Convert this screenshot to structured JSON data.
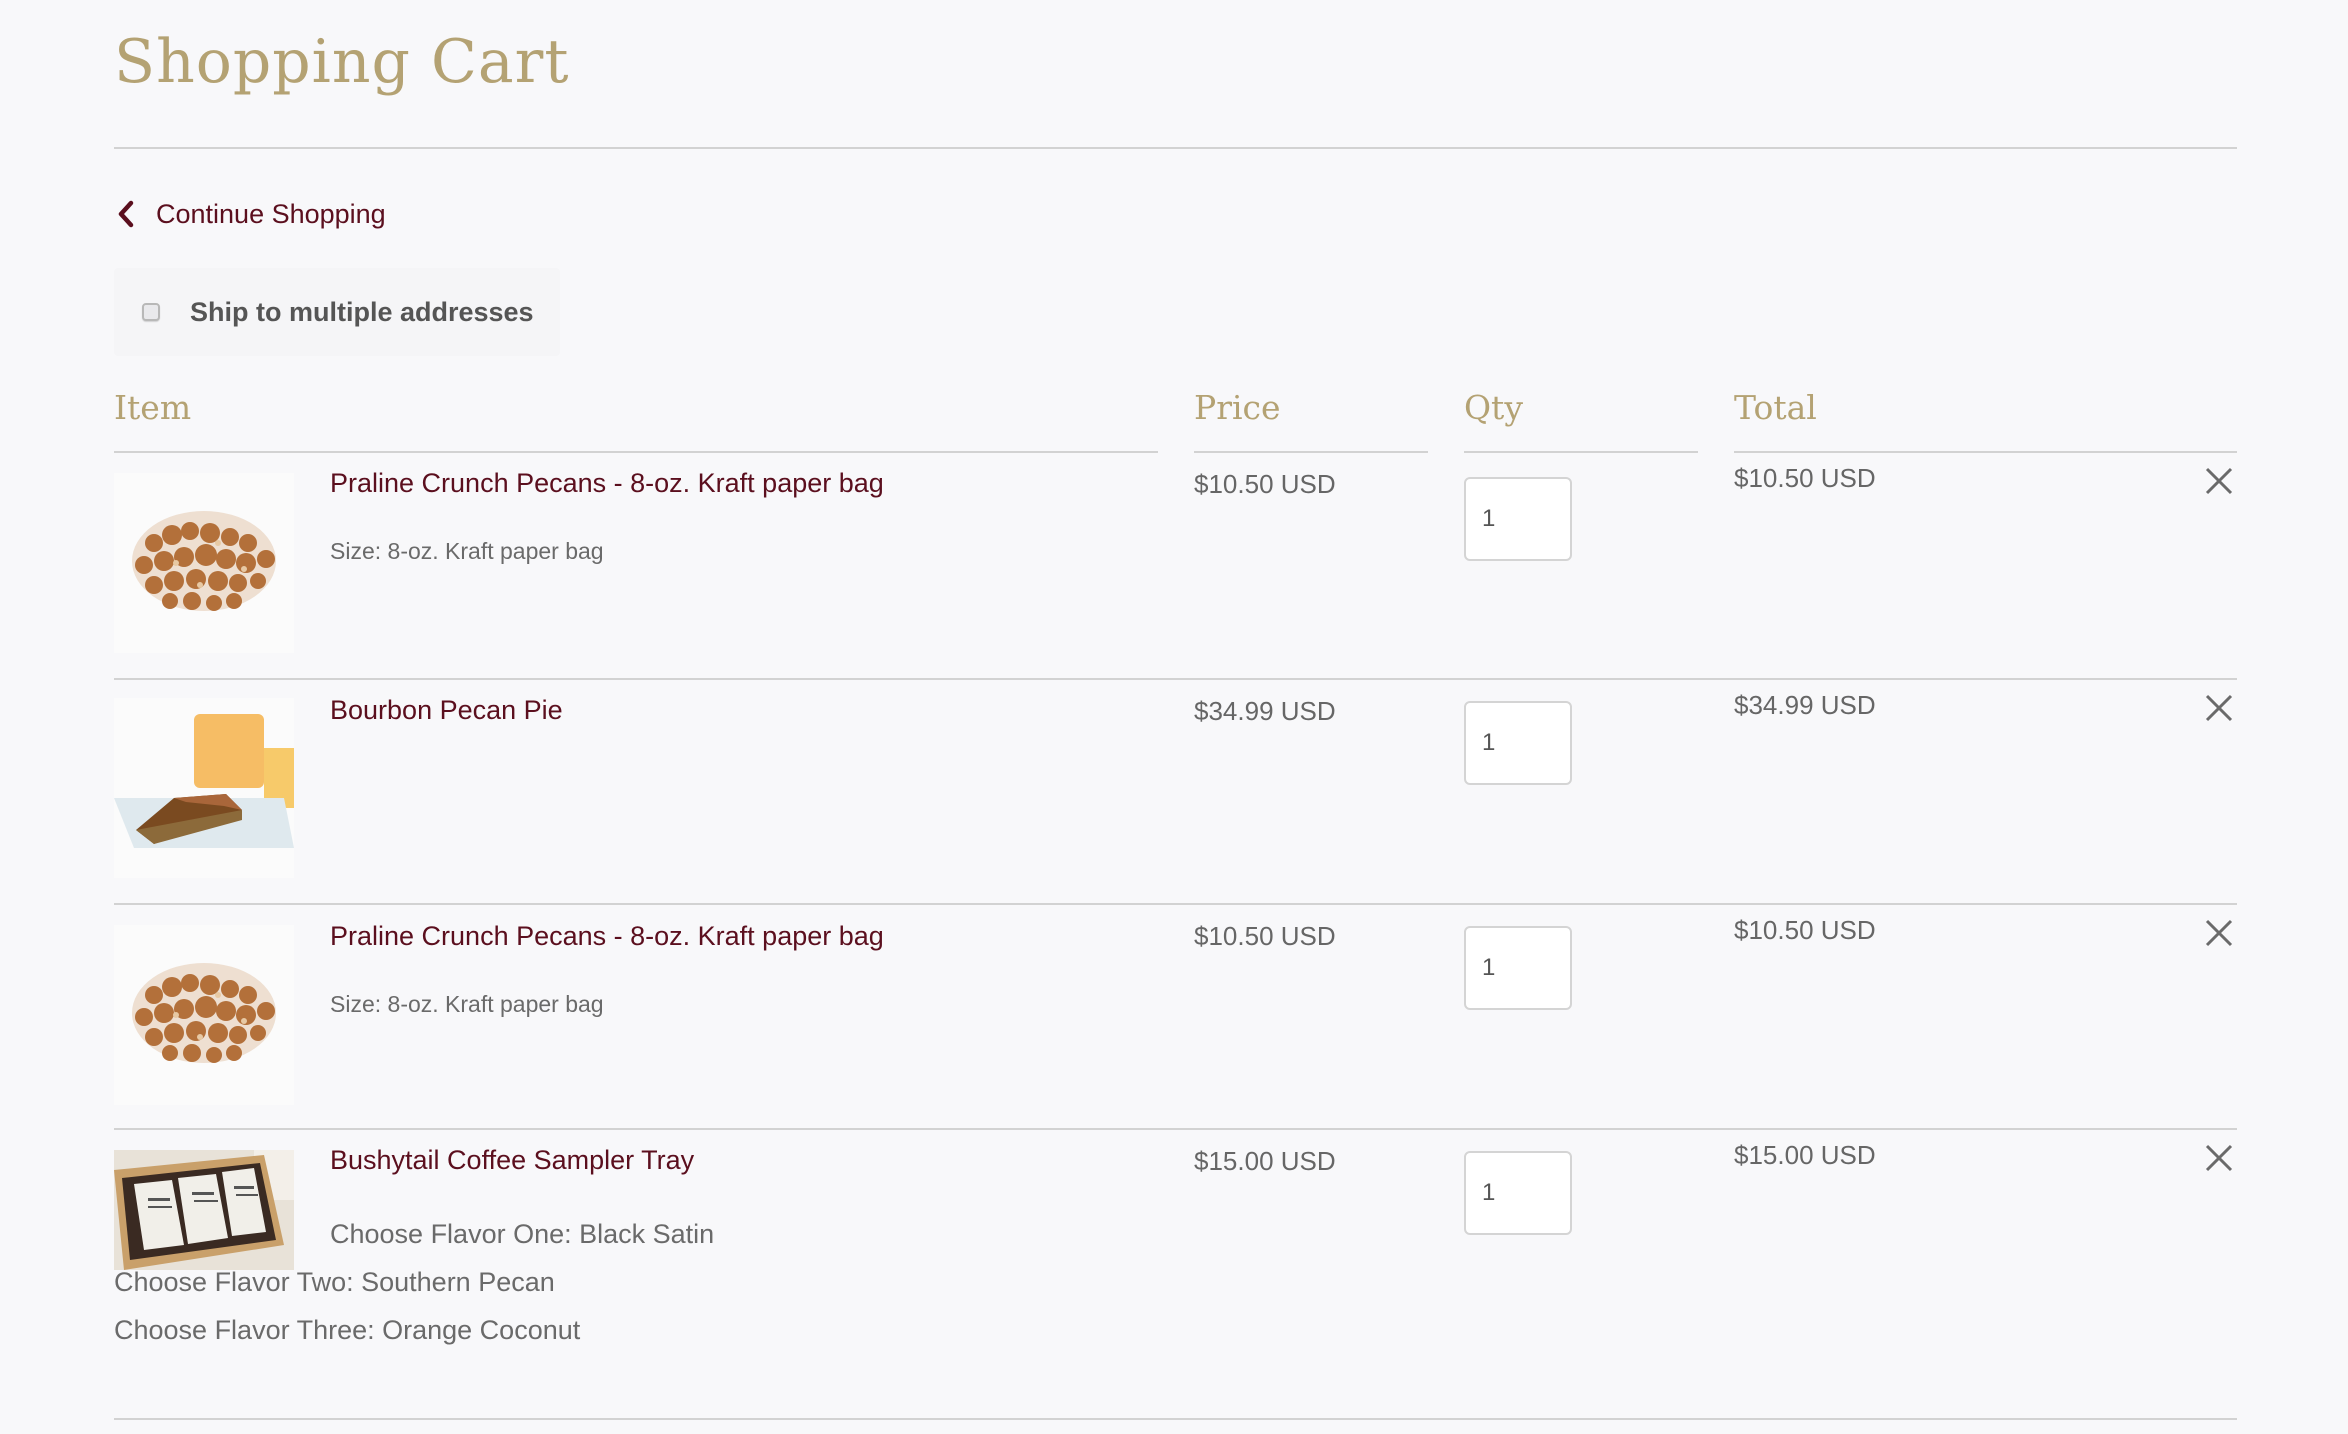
{
  "page": {
    "title": "Shopping Cart",
    "continue_shopping": {
      "label": "Continue Shopping",
      "icon": "chevron-left-icon"
    },
    "ship_multiple": {
      "label": "Ship to multiple addresses",
      "checked": false
    }
  },
  "columns": {
    "item": "Item",
    "price": "Price",
    "qty": "Qty",
    "total": "Total"
  },
  "items": [
    {
      "name": "Praline Crunch Pecans - 8-oz. Kraft paper bag",
      "image": "praline-pecans-image",
      "options": [
        "Size: 8-oz. Kraft paper bag"
      ],
      "price": "$10.50 USD",
      "qty": "1",
      "total": "$10.50 USD",
      "remove_icon": "close-icon"
    },
    {
      "name": "Bourbon Pecan Pie",
      "image": "bourbon-pecan-pie-image",
      "options": [],
      "price": "$34.99 USD",
      "qty": "1",
      "total": "$34.99 USD",
      "remove_icon": "close-icon"
    },
    {
      "name": "Praline Crunch Pecans - 8-oz. Kraft paper bag",
      "image": "praline-pecans-image",
      "options": [
        "Size: 8-oz. Kraft paper bag"
      ],
      "price": "$10.50 USD",
      "qty": "1",
      "total": "$10.50 USD",
      "remove_icon": "close-icon"
    },
    {
      "name": "Bushytail Coffee Sampler Tray",
      "image": "coffee-sampler-tray-image",
      "options": [
        "Choose Flavor One: Black Satin",
        "Choose Flavor Two: Southern Pecan",
        "Choose Flavor Three: Orange Coconut"
      ],
      "price": "$15.00 USD",
      "qty": "1",
      "total": "$15.00 USD",
      "remove_icon": "close-icon"
    }
  ],
  "colors": {
    "heading_gold": "#b4a273",
    "link_maroon": "#5b0f1e",
    "text_gray": "#666666",
    "background": "#f8f8fa",
    "rule": "#d2d2d2"
  }
}
